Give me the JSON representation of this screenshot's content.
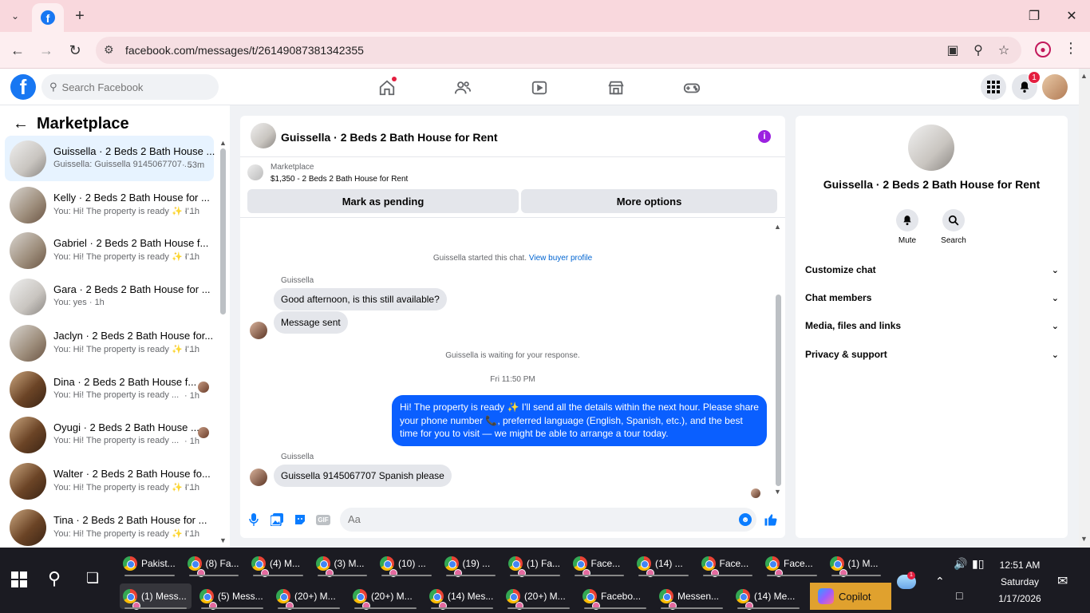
{
  "browser": {
    "url": "facebook.com/messages/t/26149087381342355"
  },
  "fb": {
    "search_placeholder": "Search Facebook",
    "notif_count": "1"
  },
  "sidebar": {
    "title": "Marketplace",
    "conversations": [
      {
        "name": "Guissella · 2 Beds 2 Bath House ...",
        "preview": "Guissella: Guissella 9145067707 ...",
        "time": "· 53m",
        "thumb": "light",
        "active": true
      },
      {
        "name": "Kelly · 2 Beds 2 Bath House for ...",
        "preview": "You: Hi! The property is ready ✨ I'...",
        "time": "· 1h",
        "thumb": "mid"
      },
      {
        "name": "Gabriel · 2 Beds 2 Bath House f...",
        "preview": "You: Hi! The property is ready ✨ I'...",
        "time": "· 1h",
        "thumb": "mid"
      },
      {
        "name": "Gara · 2 Beds 2 Bath House for ...",
        "preview": "You: yes · 1h",
        "time": "",
        "thumb": "light"
      },
      {
        "name": "Jaclyn · 2 Beds 2 Bath House for...",
        "preview": "You: Hi! The property is ready ✨ I'...",
        "time": "· 1h",
        "thumb": "mid"
      },
      {
        "name": "Dina · 2 Beds 2 Bath House f...",
        "preview": "You: Hi! The property is ready ...",
        "time": "· 1h",
        "thumb": "dark",
        "mini": true
      },
      {
        "name": "Oyugi · 2 Beds 2 Bath House ...",
        "preview": "You: Hi! The property is ready ...",
        "time": "· 1h",
        "thumb": "dark",
        "mini": true
      },
      {
        "name": "Walter · 2 Beds 2 Bath House fo...",
        "preview": "You: Hi! The property is ready ✨ I'...",
        "time": "· 1h",
        "thumb": "dark"
      },
      {
        "name": "Tina · 2 Beds 2 Bath House for ...",
        "preview": "You: Hi! The property is ready ✨ I'...",
        "time": "· 1h",
        "thumb": "dark"
      }
    ]
  },
  "chat": {
    "title": "Guissella · 2 Beds 2 Bath House for Rent",
    "marketplace_label": "Marketplace",
    "listing": "$1,350 - 2 Beds 2 Bath House for Rent",
    "mark_pending": "Mark as pending",
    "more_options": "More options",
    "started_text": "Guissella started this chat.",
    "view_profile": "View buyer profile",
    "sender1": "Guissella",
    "msg1": "Good afternoon, is this still available?",
    "msg2": "Message sent",
    "waiting_text": "Guissella is waiting for your response.",
    "timestamp": "Fri 11:50 PM",
    "out_msg": "Hi! The property is ready ✨ I'll send all the details within the next hour. Please share your phone number 📞, preferred language (English, Spanish, etc.), and the best time for you to visit — we might be able to arrange a tour today.",
    "sender2": "Guissella",
    "msg3": "Guissella 9145067707 Spanish please",
    "composer_placeholder": "Aa"
  },
  "info_panel": {
    "title": "Guissella · 2 Beds 2 Bath House for Rent",
    "mute": "Mute",
    "search": "Search",
    "rows": [
      "Customize chat",
      "Chat members",
      "Media, files and links",
      "Privacy & support"
    ]
  },
  "taskbar": {
    "row1": [
      {
        "label": "Pakist...",
        "badge": false
      },
      {
        "label": "(8) Fa...",
        "badge": true
      },
      {
        "label": "(4) M...",
        "badge": true
      },
      {
        "label": "(3) M...",
        "badge": true
      },
      {
        "label": "(10) ...",
        "badge": true
      },
      {
        "label": "(19) ...",
        "badge": true
      },
      {
        "label": "(1) Fa...",
        "badge": true
      },
      {
        "label": "Face...",
        "badge": true
      },
      {
        "label": "(14) ...",
        "badge": true
      },
      {
        "label": "Face...",
        "badge": true
      },
      {
        "label": "Face...",
        "badge": true
      },
      {
        "label": "(1) M...",
        "badge": true
      }
    ],
    "row2": [
      {
        "label": "(1) Mess...",
        "badge": true,
        "active": true
      },
      {
        "label": "(5) Mess...",
        "badge": true
      },
      {
        "label": "(20+) M...",
        "badge": true
      },
      {
        "label": "(20+) M...",
        "badge": true
      },
      {
        "label": "(14) Mes...",
        "badge": true
      },
      {
        "label": "(20+) M...",
        "badge": true
      },
      {
        "label": "Facebo...",
        "badge": true
      },
      {
        "label": "Messen...",
        "badge": true
      },
      {
        "label": "(14) Me...",
        "badge": true
      }
    ],
    "copilot": "Copilot",
    "weather_badge": "1",
    "time": "12:51 AM",
    "day": "Saturday",
    "date": "1/17/2026"
  }
}
